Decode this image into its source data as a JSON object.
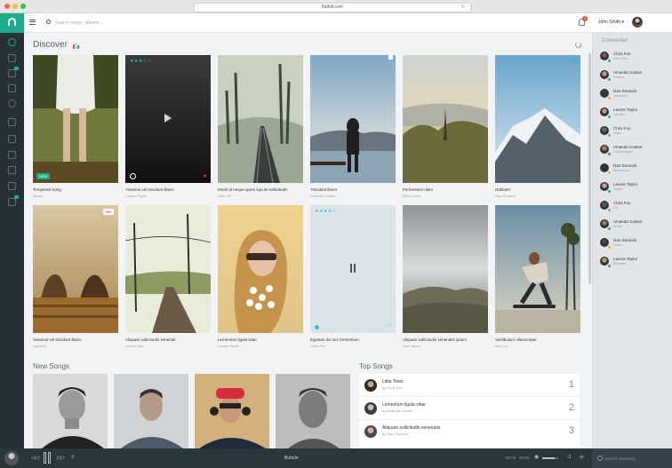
{
  "browser": {
    "url": "flatfull.com",
    "traffic_lights": [
      "#ff5f57",
      "#febc2e",
      "#28c840"
    ]
  },
  "colors": {
    "accent": "#1dad8e",
    "sidebar_bg": "#273036",
    "player_bg": "#2b363c",
    "notification": "#e74c3c",
    "star": "#3fb6ce"
  },
  "sidebar": {
    "logo_icon": "headphones-icon",
    "items": [
      {
        "icon": "discover-icon",
        "active": true,
        "badge": false
      },
      {
        "icon": "music-note-icon",
        "active": false,
        "badge": false
      },
      {
        "icon": "inbox-icon",
        "active": false,
        "badge": true
      },
      {
        "icon": "mail-icon",
        "active": false,
        "badge": false
      },
      {
        "icon": "radio-icon",
        "active": false,
        "badge": false
      },
      {
        "icon": "monitor-icon",
        "active": false,
        "badge": false
      },
      {
        "icon": "microphone-icon",
        "active": false,
        "badge": false
      },
      {
        "icon": "list-icon",
        "active": false,
        "badge": false
      },
      {
        "icon": "grid-icon",
        "active": false,
        "badge": false
      },
      {
        "icon": "note-icon",
        "active": false,
        "badge": false
      },
      {
        "icon": "bookmark-icon",
        "active": false,
        "badge": true
      }
    ]
  },
  "topbar": {
    "search_placeholder": "Search songs, albums...",
    "notification_count": "3",
    "username": "John Smith ▾"
  },
  "discover": {
    "title": "Discover",
    "cards": [
      {
        "title": "Tempered Song",
        "artist": "Miaow",
        "badge": "NEW"
      },
      {
        "title": "Vivamus vel tincidunt libero",
        "artist": "Lauren Taylor",
        "stars": "★★★☆☆"
      },
      {
        "title": "Morbi id neque quam liqcum sollicitudin",
        "artist": "Allen JH"
      },
      {
        "title": "Tincidunt libero",
        "artist": "Amanda Conlan"
      },
      {
        "title": "Fermentum diam",
        "artist": "Rita Cohen"
      },
      {
        "title": "Habitant",
        "artist": "Dan Doorack"
      },
      {
        "title": "Vivamus vel tincidunt libero",
        "artist": "Ligulai-b",
        "tag": "HD"
      },
      {
        "title": "Aliquam sollicitudin venenati",
        "artist": "James Garr"
      },
      {
        "title": "Lementum ligula vitae",
        "artist": "Lauren Taylor"
      },
      {
        "title": "Egestas dui nec fermentum",
        "artist": "Chris Fox",
        "stars": "★★★★☆"
      },
      {
        "title": "Aliquam sollicitudin venenatis ipsum",
        "artist": "Lark Jason"
      },
      {
        "title": "Vestibulum ullamcorper",
        "artist": "Alex Liu"
      }
    ]
  },
  "new_songs": {
    "title": "New Songs"
  },
  "top_songs": {
    "title": "Top Songs",
    "items": [
      {
        "title": "Little Town",
        "artist": "by Chris Fox",
        "rank": "1"
      },
      {
        "title": "Lementum ligula vitae",
        "artist": "by Amanda Conlan",
        "rank": "2"
      },
      {
        "title": "Aliquam sollicitudin venenatis",
        "artist": "by Dan Doorack",
        "rank": "3"
      }
    ]
  },
  "connected": {
    "title": "Connected",
    "contacts": [
      {
        "name": "Chris Fox",
        "location": "New York",
        "status": "#1dad8e"
      },
      {
        "name": "Amanda Conlan",
        "location": "France",
        "status": "#1dad8e"
      },
      {
        "name": "Dan Doorack",
        "location": "Hamburg",
        "status": "#f0ad4e"
      },
      {
        "name": "Lauren Taylor",
        "location": "London",
        "status": "#1dad8e"
      },
      {
        "name": "Chris Fox",
        "location": "Milan",
        "status": "#999999"
      },
      {
        "name": "Amanda Conlan",
        "location": "Copenhagen",
        "status": "#1dad8e"
      },
      {
        "name": "Dan Doorack",
        "location": "Barcelona",
        "status": "#f0ad4e"
      },
      {
        "name": "Lauren Taylor",
        "location": "Tokyo",
        "status": "#1dad8e"
      },
      {
        "name": "Chris Fox",
        "location": "UK",
        "status": "#999999"
      },
      {
        "name": "Amanda Conlan",
        "location": "Africa",
        "status": "#1dad8e"
      },
      {
        "name": "Dan Doorack",
        "location": "Paris",
        "status": "#f0ad4e"
      },
      {
        "name": "Lauren Taylor",
        "location": "Brussels",
        "status": "#1dad8e"
      }
    ]
  },
  "player": {
    "track": "Bubble",
    "current_time": "00:00",
    "duration": "00:00",
    "volume": 0.8,
    "search_placeholder": "Search members"
  }
}
